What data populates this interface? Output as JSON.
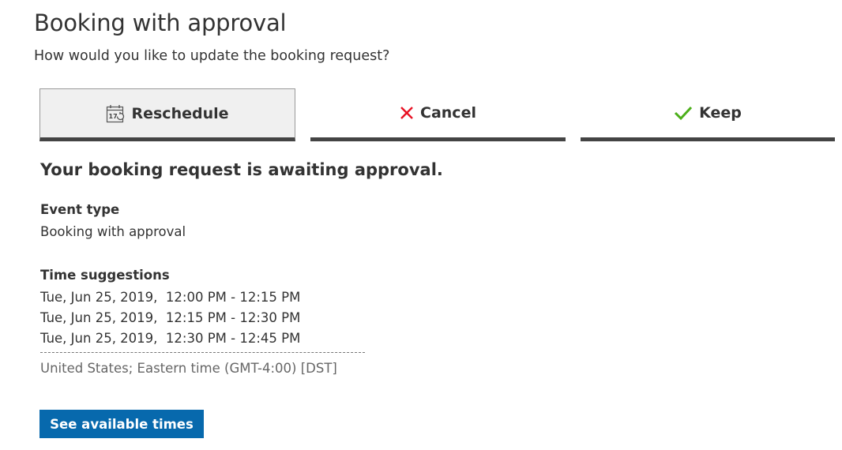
{
  "header": {
    "title": "Booking with approval",
    "subtitle": "How would you like to update the booking request?"
  },
  "tabs": [
    {
      "label": "Reschedule",
      "icon": "calendar-reschedule-icon",
      "selected": true,
      "calendar_day": "17"
    },
    {
      "label": "Cancel",
      "icon": "x-icon",
      "icon_color": "#e81123",
      "selected": false
    },
    {
      "label": "Keep",
      "icon": "checkmark-icon",
      "icon_color": "#4caf1a",
      "selected": false
    }
  ],
  "main": {
    "status_heading": "Your booking request is awaiting approval.",
    "event_type_label": "Event type",
    "event_type_value": "Booking with approval",
    "time_suggestions_label": "Time suggestions",
    "time_suggestions": [
      "Tue, Jun 25, 2019,  12:00 PM - 12:15 PM",
      "Tue, Jun 25, 2019,  12:15 PM - 12:30 PM",
      "Tue, Jun 25, 2019,  12:30 PM - 12:45 PM"
    ],
    "timezone": "United States; Eastern time (GMT-4:00) [DST]",
    "see_times_button": "See available times"
  },
  "colors": {
    "primary_button": "#0769ad",
    "tab_underline": "#444444",
    "selected_tab_bg": "#f0f0f0"
  }
}
